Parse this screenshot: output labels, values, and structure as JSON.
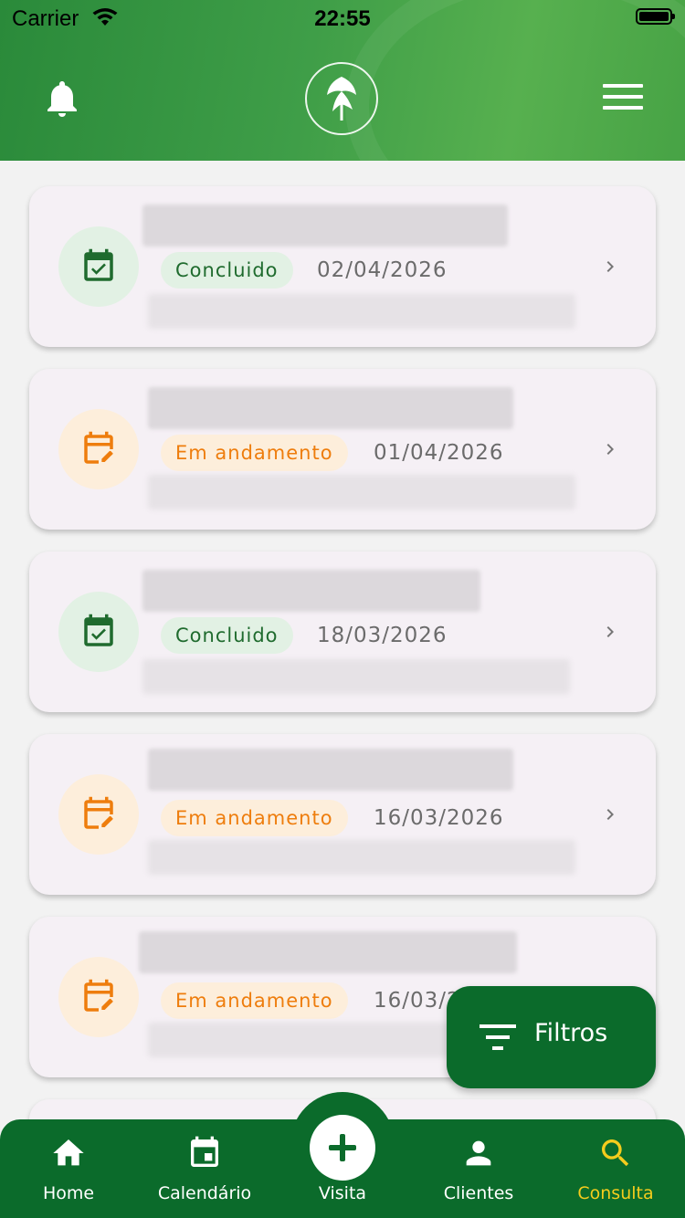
{
  "status_bar": {
    "carrier": "Carrier",
    "time": "22:55"
  },
  "header": {
    "bell_icon": "bell-icon",
    "logo": "leaf-logo",
    "menu_icon": "menu-icon"
  },
  "visits": [
    {
      "status": "Concluido",
      "date": "02/04/2026",
      "kind": "done",
      "icon": "calendar-check-icon"
    },
    {
      "status": "Em andamento",
      "date": "01/04/2026",
      "kind": "progress",
      "icon": "calendar-edit-icon"
    },
    {
      "status": "Concluido",
      "date": "18/03/2026",
      "kind": "done",
      "icon": "calendar-check-icon"
    },
    {
      "status": "Em andamento",
      "date": "16/03/2026",
      "kind": "progress",
      "icon": "calendar-edit-icon"
    },
    {
      "status": "Em andamento",
      "date": "16/03/2026",
      "kind": "progress",
      "icon": "calendar-edit-icon"
    }
  ],
  "filter_button": {
    "label": "Filtros"
  },
  "nav": {
    "home": "Home",
    "calendar": "Calendário",
    "visit": "Visita",
    "clients": "Clientes",
    "search": "Consulta"
  },
  "colors": {
    "brand_green": "#0b6b2b",
    "done_green": "#1f6b2e",
    "progress_orange": "#ee7d0d",
    "active_nav": "#f4cc1d"
  }
}
